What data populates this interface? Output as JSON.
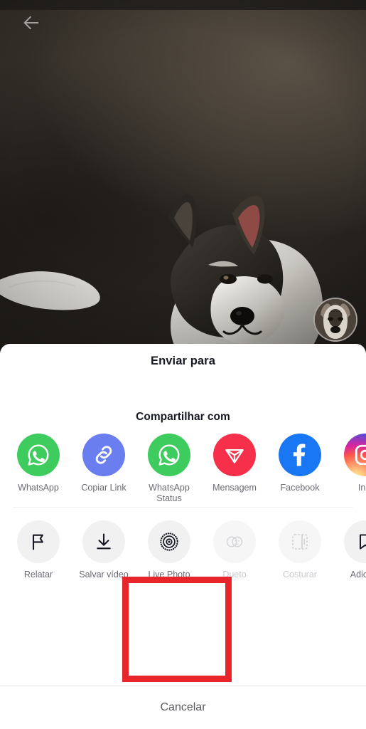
{
  "video": {
    "back_icon": "back-arrow-icon",
    "avatar_alt": "husky-avatar"
  },
  "sheet": {
    "title": "Enviar para",
    "share_section_title": "Compartilhar com",
    "share_items": [
      {
        "label": "WhatsApp",
        "icon": "whatsapp-icon",
        "color": "#3ecc5f",
        "disabled": false
      },
      {
        "label": "Copiar Link",
        "icon": "link-icon",
        "color": "#6b7ef0",
        "disabled": false
      },
      {
        "label": "WhatsApp Status",
        "icon": "whatsapp-status-icon",
        "color": "#3ecc5f",
        "disabled": false
      },
      {
        "label": "Mensagem",
        "icon": "send-message-icon",
        "color": "#f6304a",
        "disabled": false
      },
      {
        "label": "Facebook",
        "icon": "facebook-icon",
        "color": "#1977f3",
        "disabled": false
      },
      {
        "label": "Inst",
        "icon": "instagram-icon",
        "color": "#d62976",
        "disabled": false
      }
    ],
    "action_items": [
      {
        "label": "Relatar",
        "icon": "flag-icon",
        "disabled": false
      },
      {
        "label": "Salvar vídeo",
        "icon": "download-icon",
        "disabled": false
      },
      {
        "label": "Live Photo",
        "icon": "live-photo-icon",
        "disabled": false
      },
      {
        "label": "Dueto",
        "icon": "duet-icon",
        "disabled": true
      },
      {
        "label": "Costurar",
        "icon": "stitch-icon",
        "disabled": true
      },
      {
        "label": "Adic Fa",
        "icon": "favorite-icon",
        "disabled": false
      }
    ],
    "cancel_label": "Cancelar"
  },
  "annotation": {
    "name": "red-highlight-box",
    "color": "#e8252a",
    "targets": "Live Photo"
  }
}
